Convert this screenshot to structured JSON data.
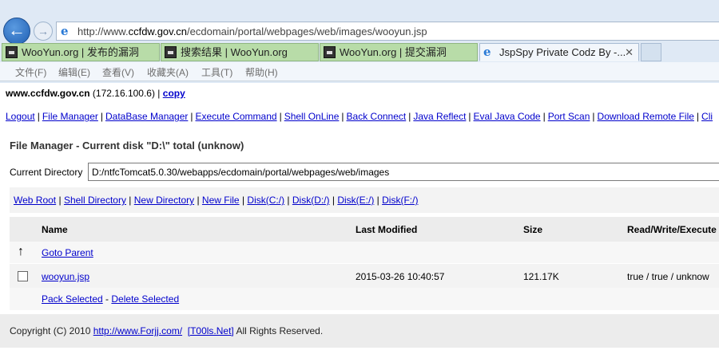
{
  "browser": {
    "url_prefix": "http://www.",
    "url_domain": "ccfdw.gov.cn",
    "url_path": "/ecdomain/portal/webpages/web/images/wooyun.jsp",
    "tabs": [
      {
        "label": "WooYun.org | 发布的漏洞"
      },
      {
        "label": "搜索结果 | WooYun.org"
      },
      {
        "label": "WooYun.org | 提交漏洞"
      },
      {
        "label": "JspSpy Private Codz By -...",
        "close": "✕"
      }
    ],
    "menu": [
      "文件(F)",
      "编辑(E)",
      "查看(V)",
      "收藏夹(A)",
      "工具(T)",
      "帮助(H)"
    ]
  },
  "page": {
    "host": "www.ccfdw.gov.cn",
    "ip": " (172.16.100.6) | ",
    "copy_link": "copy",
    "nav_links": [
      "Logout",
      "File Manager",
      "DataBase Manager",
      "Execute Command",
      "Shell OnLine",
      "Back Connect",
      "Java Reflect",
      "Eval Java Code",
      "Port Scan",
      "Download Remote File",
      "Cli"
    ],
    "title": "File Manager - Current disk \"D:\\\" total (unknow)",
    "current_dir_label": "Current Directory",
    "current_dir_value": "D:/ntfcTomcat5.0.30/webapps/ecdomain/portal/webpages/web/images",
    "disk_links": [
      "Web Root",
      "Shell Directory",
      "New Directory",
      "New File",
      "Disk(C:/)",
      "Disk(D:/)",
      "Disk(E:/)",
      "Disk(F:/)"
    ],
    "table": {
      "headers": {
        "name": "Name",
        "modified": "Last Modified",
        "size": "Size",
        "rwx": "Read/Write/Execute"
      },
      "parent_label": "Goto Parent",
      "files": [
        {
          "name": "wooyun.jsp",
          "modified": "2015-03-26 10:40:57",
          "size": "121.17K",
          "rwx": "true / true / unknow"
        }
      ],
      "pack_label": "Pack Selected",
      "delete_label": "Delete Selected"
    },
    "footer": {
      "copyright": "Copyright (C) 2010 ",
      "link1": "http://www.Forjj.com/",
      "link2": "[T00ls.Net]",
      "rights": " All Rights Reserved."
    }
  }
}
